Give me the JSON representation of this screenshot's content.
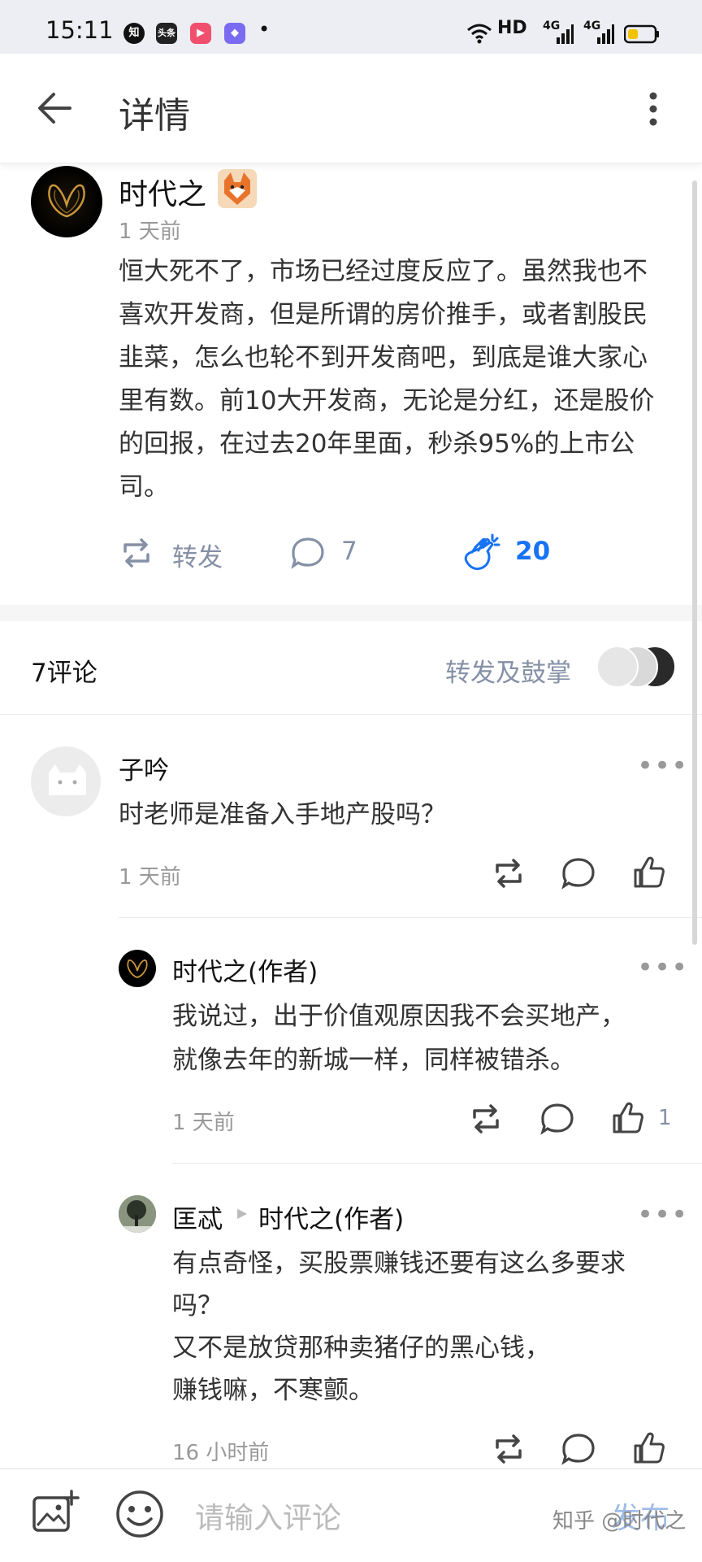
{
  "status_bar": {
    "time": "15:11",
    "apps": [
      {
        "icon": "zhihu-app-icon",
        "label": "知",
        "color": "#111111"
      },
      {
        "icon": "toutiao-app-icon",
        "label": "头条",
        "color": "#222222"
      },
      {
        "icon": "video-app-icon",
        "label": "▶",
        "color": "#f0506e"
      },
      {
        "icon": "app-icon",
        "label": "◆",
        "color": "#7a6cf0"
      }
    ],
    "dot": "•",
    "network": "HD",
    "signal1": "4G",
    "signal2": "4G"
  },
  "header": {
    "title": "详情"
  },
  "post": {
    "author": "时代之",
    "time": "1 天前",
    "text": "恒大死不了，市场已经过度反应了。虽然我也不喜欢开发商，但是所谓的房价推手，或者割股民韭菜，怎么也轮不到开发商吧，到底是谁大家心里有数。前10大开发商，无论是分红，还是股价的回报，在过去20年里面，秒杀95%的上市公司。",
    "repost_label": "转发",
    "comment_count": "7",
    "clap_count": "20"
  },
  "comments_section": {
    "title": "7评论",
    "reshare_label": "转发及鼓掌"
  },
  "comments": [
    {
      "name": "子吟",
      "text": "时老师是准备入手地产股吗？",
      "time": "1 天前",
      "likes": ""
    },
    {
      "name": "时代之(作者)",
      "text_lines": [
        "我说过，出于价值观原因我不会买地产，",
        "就像去年的新城一样，同样被错杀。"
      ],
      "time": "1 天前",
      "likes": "1"
    },
    {
      "name": "匡忒",
      "reply_to": "时代之(作者)",
      "text_lines": [
        "有点奇怪，买股票赚钱还要有这么多要求",
        "吗？",
        "又不是放贷那种卖猪仔的黑心钱，",
        "赚钱嘛，不寒颤。"
      ],
      "time": "16 小时前",
      "likes": ""
    }
  ],
  "more_label": "•••",
  "bottom_bar": {
    "placeholder": "请输入评论",
    "publish_label": "发布",
    "watermark": "知乎 @时代之"
  }
}
